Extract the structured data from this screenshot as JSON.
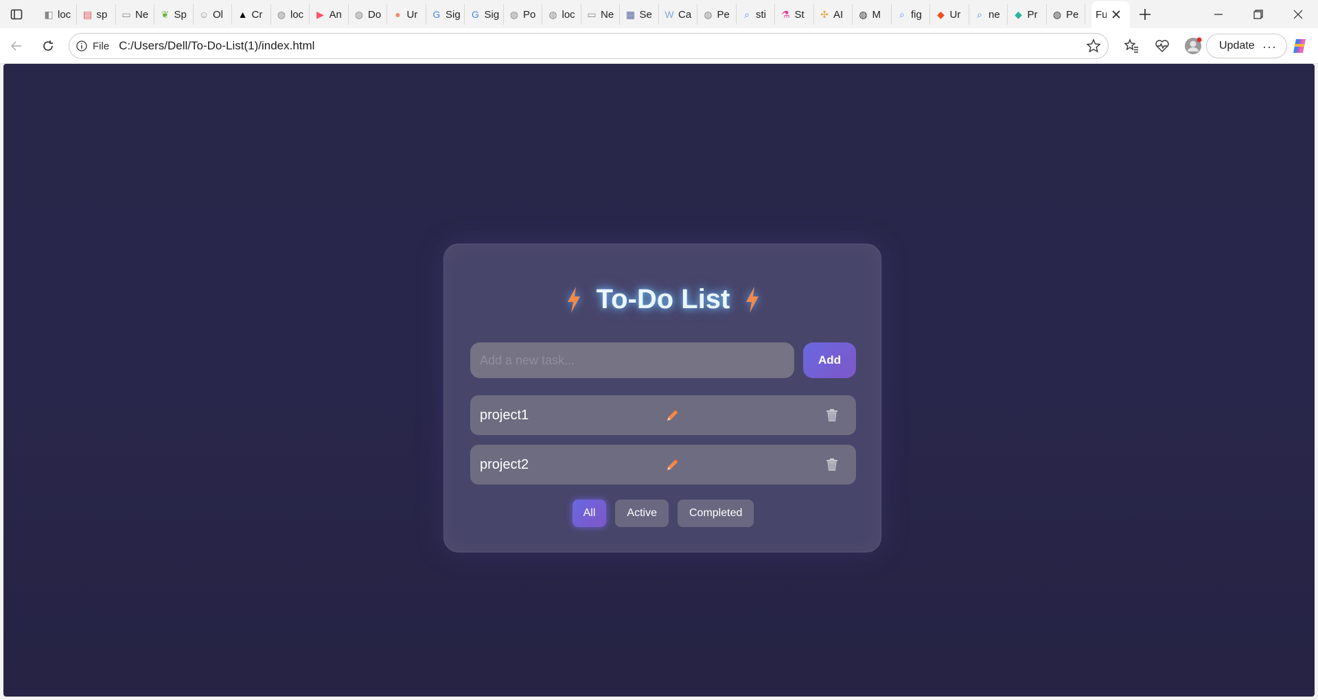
{
  "browser": {
    "tabs": [
      {
        "label": "loc",
        "icon": "page-icon",
        "color": "#888888"
      },
      {
        "label": "sp",
        "icon": "pdf-icon",
        "color": "#d9534f"
      },
      {
        "label": "Ne",
        "icon": "newtab-icon",
        "color": "#888888"
      },
      {
        "label": "Sp",
        "icon": "spring-icon",
        "color": "#6db33f"
      },
      {
        "label": "Ol",
        "icon": "ollama-icon",
        "color": "#999999"
      },
      {
        "label": "Cr",
        "icon": "triangle-icon",
        "color": "#000000"
      },
      {
        "label": "loc",
        "icon": "globe-icon",
        "color": "#888888"
      },
      {
        "label": "An",
        "icon": "youtube-icon",
        "color": "#ff4e6a"
      },
      {
        "label": "Do",
        "icon": "globe-icon",
        "color": "#888888"
      },
      {
        "label": "Ur",
        "icon": "peach-icon",
        "color": "#f08a6c"
      },
      {
        "label": "Sig",
        "icon": "google-icon",
        "color": "#4285f4"
      },
      {
        "label": "Sig",
        "icon": "google-icon",
        "color": "#4285f4"
      },
      {
        "label": "Po",
        "icon": "globe-icon",
        "color": "#888888"
      },
      {
        "label": "loc",
        "icon": "globe-icon",
        "color": "#888888"
      },
      {
        "label": "Ne",
        "icon": "newtab-icon",
        "color": "#888888"
      },
      {
        "label": "Se",
        "icon": "bank-icon",
        "color": "#5a6aa0"
      },
      {
        "label": "Ca",
        "icon": "w-icon",
        "color": "#7fa8d8"
      },
      {
        "label": "Pe",
        "icon": "globe-icon",
        "color": "#888888"
      },
      {
        "label": "sti",
        "icon": "search-icon",
        "color": "#5b8def"
      },
      {
        "label": "St",
        "icon": "flask-icon",
        "color": "#e0399a"
      },
      {
        "label": "AI",
        "icon": "pinwheel-icon",
        "color": "#e7a33e"
      },
      {
        "label": "M",
        "icon": "globe-icon",
        "color": "#333333"
      },
      {
        "label": "fig",
        "icon": "search-icon",
        "color": "#5b8def"
      },
      {
        "label": "Ur",
        "icon": "figma-icon",
        "color": "#f24e1e"
      },
      {
        "label": "ne",
        "icon": "search-icon",
        "color": "#5b8def"
      },
      {
        "label": "Pr",
        "icon": "diamond-icon",
        "color": "#2bb59a"
      },
      {
        "label": "Pe",
        "icon": "globe-icon",
        "color": "#333333"
      }
    ],
    "active_tab": {
      "label": "Fu"
    },
    "address": {
      "scheme_label": "File",
      "url": "C:/Users/Dell/To-Do-List(1)/index.html"
    },
    "update_label": "Update"
  },
  "app": {
    "title": "To-Do List",
    "input": {
      "placeholder": "Add a new task...",
      "value": ""
    },
    "add_label": "Add",
    "tasks": [
      {
        "name": "project1"
      },
      {
        "name": "project2"
      }
    ],
    "filters": [
      {
        "label": "All",
        "active": true
      },
      {
        "label": "Active",
        "active": false
      },
      {
        "label": "Completed",
        "active": false
      }
    ],
    "colors": {
      "background": "#282749",
      "card": "#48456a",
      "accent": "#6a67e0",
      "bolt": "#f2894a",
      "title_glow": "#78c8ff"
    }
  }
}
